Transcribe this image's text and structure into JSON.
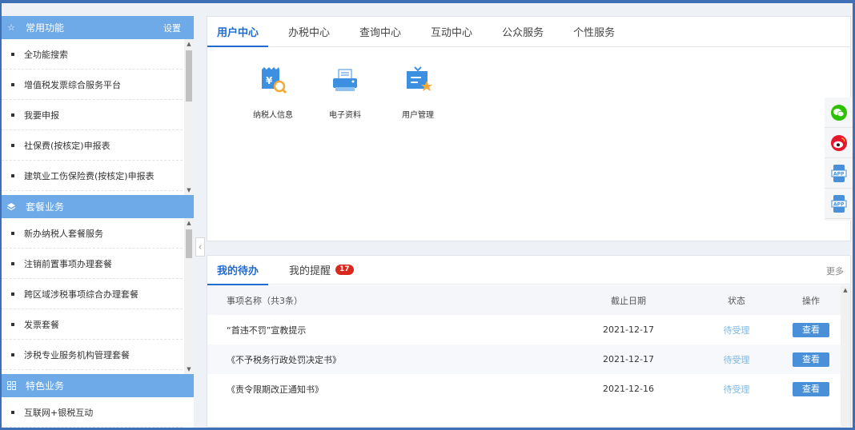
{
  "sidebar": {
    "sections": [
      {
        "title": "常用功能",
        "icon": "star-icon",
        "settings_label": "设置",
        "items": [
          "全功能搜索",
          "增值税发票综合服务平台",
          "我要申报",
          "社保费(按核定)申报表",
          "建筑业工伤保险费(按核定)申报表"
        ]
      },
      {
        "title": "套餐业务",
        "icon": "layers-icon",
        "items": [
          "新办纳税人套餐服务",
          "注销前置事项办理套餐",
          "跨区域涉税事项综合办理套餐",
          "发票套餐",
          "涉税专业服务机构管理套餐"
        ]
      },
      {
        "title": "特色业务",
        "icon": "grid-icon",
        "items": [
          "互联网+银税互动"
        ]
      }
    ]
  },
  "top_panel": {
    "tabs": [
      "用户中心",
      "办税中心",
      "查询中心",
      "互动中心",
      "公众服务",
      "个性服务"
    ],
    "active_tab": 0,
    "tiles": [
      {
        "label": "纳税人信息",
        "icon": "taxpayer-info-icon"
      },
      {
        "label": "电子资料",
        "icon": "electronic-docs-icon"
      },
      {
        "label": "用户管理",
        "icon": "user-management-icon"
      }
    ]
  },
  "float_bar": {
    "buttons": [
      {
        "icon": "wechat-icon",
        "color": "#2dc100"
      },
      {
        "icon": "weibo-icon",
        "color": "#e6162d"
      },
      {
        "icon": "app-icon",
        "color": "#4a90d9"
      },
      {
        "icon": "app-icon",
        "color": "#4a90d9"
      }
    ]
  },
  "bottom_panel": {
    "tabs": [
      "我的待办",
      "我的提醒"
    ],
    "reminder_count": "17",
    "more_label": "更多",
    "table": {
      "headers": [
        "事项名称（共3条）",
        "截止日期",
        "状态",
        "操作"
      ],
      "rows": [
        {
          "name": "“首违不罚”宣教提示",
          "date": "2021-12-17",
          "status": "待受理",
          "action": "查看"
        },
        {
          "name": "《不予税务行政处罚决定书》",
          "date": "2021-12-17",
          "status": "待受理",
          "action": "查看"
        },
        {
          "name": "《责令限期改正通知书》",
          "date": "2021-12-16",
          "status": "待受理",
          "action": "查看"
        }
      ]
    }
  },
  "colors": {
    "accent": "#1f6bd1",
    "sidebar_header": "#6ea9e8",
    "badge": "#d9281e",
    "button": "#4a90d9"
  }
}
